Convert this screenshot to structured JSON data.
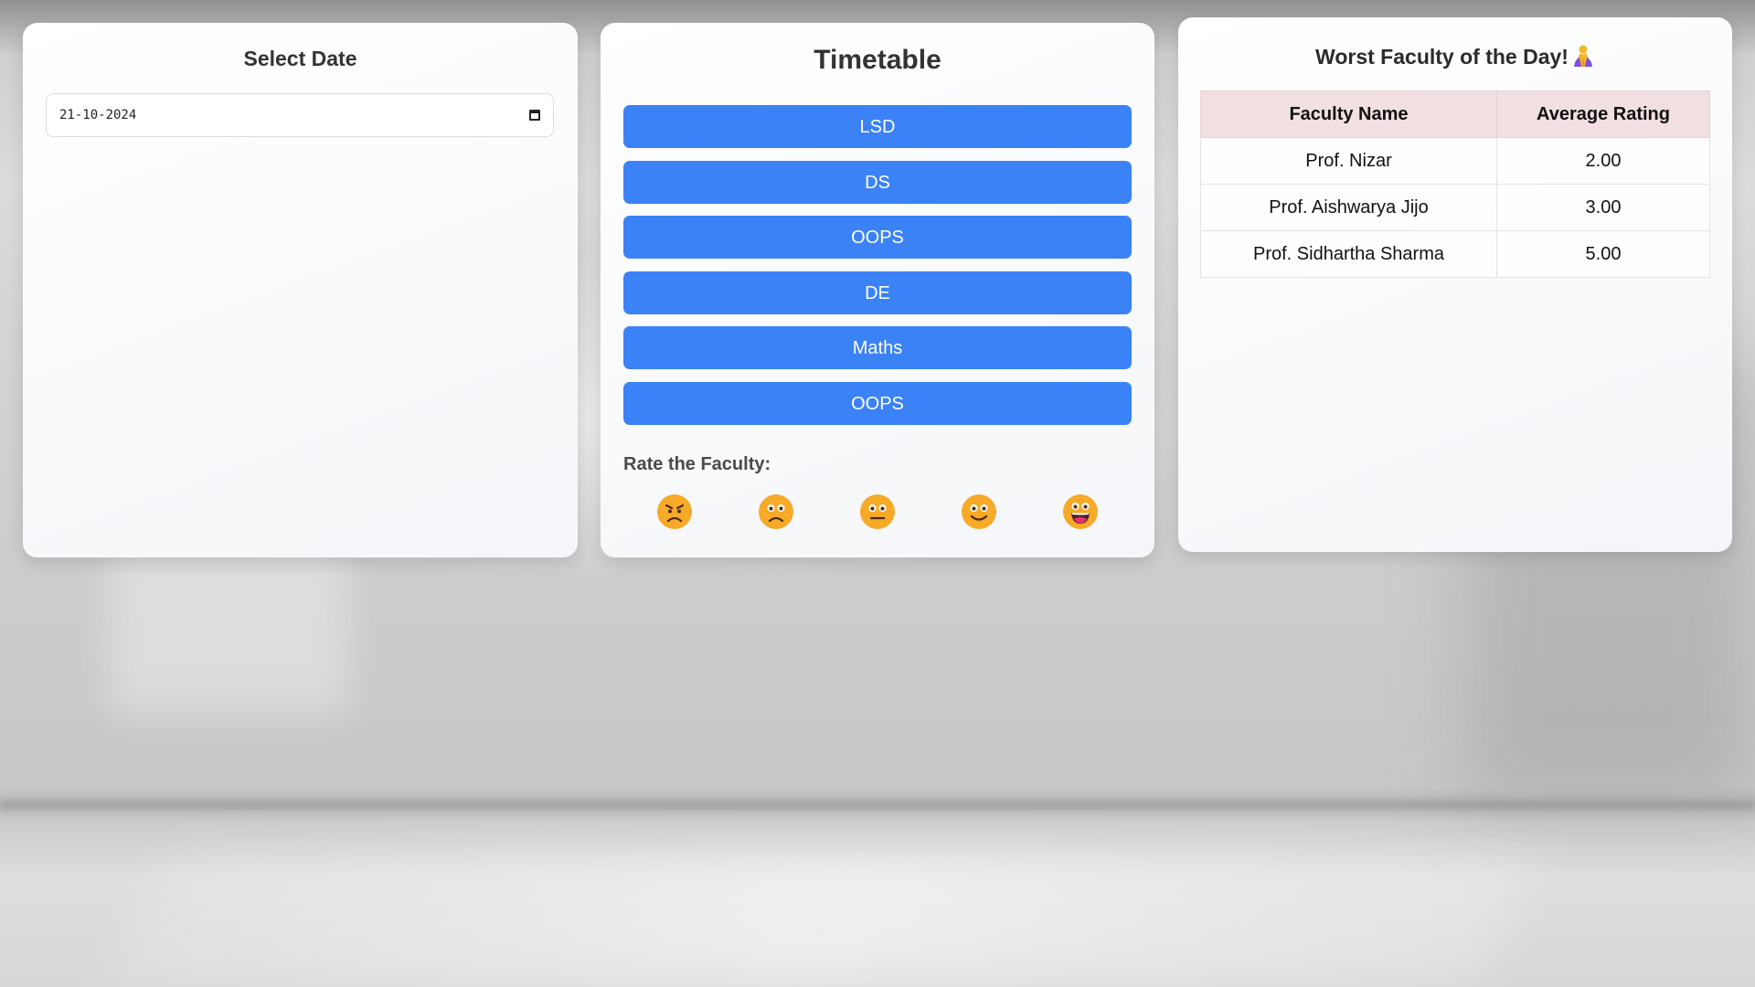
{
  "date_panel": {
    "title": "Select Date",
    "date_value": "21-10-2024"
  },
  "timetable": {
    "title": "Timetable",
    "subjects": [
      "LSD",
      "DS",
      "OOPS",
      "DE",
      "Maths",
      "OOPS"
    ],
    "rate_label": "Rate the Faculty:",
    "ratings": [
      "angry-face-icon",
      "frowning-face-icon",
      "neutral-face-icon",
      "slightly-smiling-face-icon",
      "grinning-face-icon"
    ]
  },
  "worst_faculty": {
    "title": "Worst Faculty of the Day!",
    "title_icon": "folded-hands-icon",
    "columns": [
      "Faculty Name",
      "Average Rating"
    ],
    "rows": [
      {
        "name": "Prof. Nizar",
        "rating": "2.00"
      },
      {
        "name": "Prof. Aishwarya Jijo",
        "rating": "3.00"
      },
      {
        "name": "Prof. Sidhartha Sharma",
        "rating": "5.00"
      }
    ]
  },
  "colors": {
    "button": "#3b82f6",
    "table_header": "#f1dfe1",
    "emoji_face": "#f7a928"
  }
}
